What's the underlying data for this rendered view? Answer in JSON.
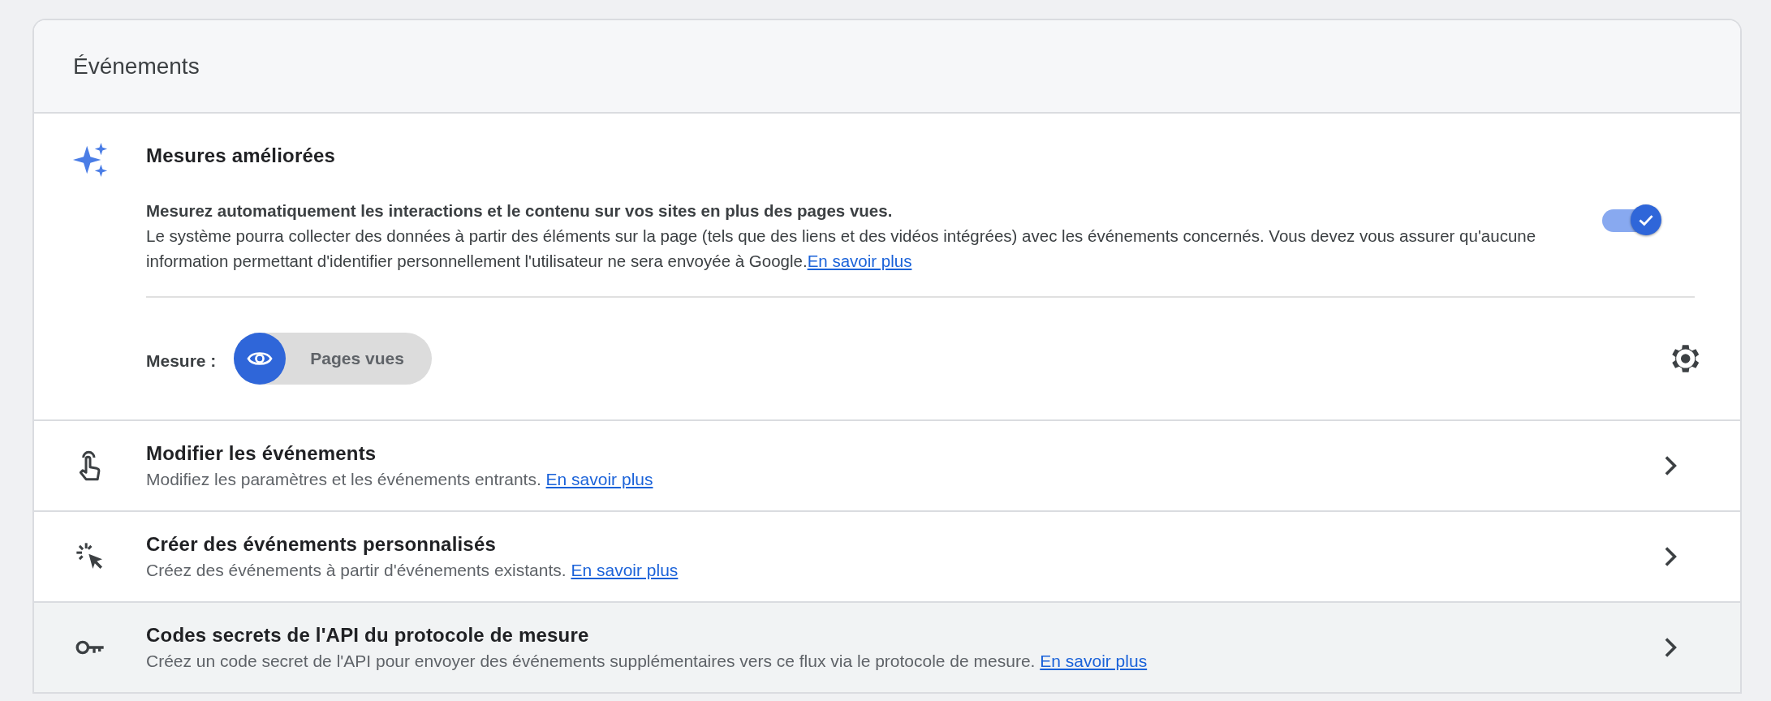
{
  "card": {
    "title": "Événements"
  },
  "enhanced": {
    "title": "Mesures améliorées",
    "toggle": {
      "on": true
    },
    "lead": "Mesurez automatiquement les interactions et le contenu sur vos sites en plus des pages vues.",
    "text": "Le système pourra collecter des données à partir des éléments sur la page (tels que des liens et des vidéos intégrées) avec les événements concernés. Vous devez vous assurer qu'aucune information permettant d'identifier personnellement l'utilisateur ne sera envoyée à Google.",
    "link": "En savoir plus",
    "measure_label": "Mesure :",
    "chips": [
      {
        "label": "Pages vues",
        "selected": true
      }
    ]
  },
  "rows": [
    {
      "kind": "touch",
      "title": "Modifier les événements",
      "text": "Modifiez les paramètres et les événements entrants.",
      "link": "En savoir plus",
      "highlighted": false
    },
    {
      "kind": "click",
      "title": "Créer des événements personnalisés",
      "text": "Créez des événements à partir d'événements existants.",
      "link": "En savoir plus",
      "highlighted": false
    },
    {
      "kind": "key",
      "title": "Codes secrets de l'API du protocole de mesure",
      "text": "Créez un code secret de l'API pour envoyer des événements supplémentaires vers ce flux via le protocole de mesure.",
      "link": "En savoir plus",
      "highlighted": true
    }
  ]
}
